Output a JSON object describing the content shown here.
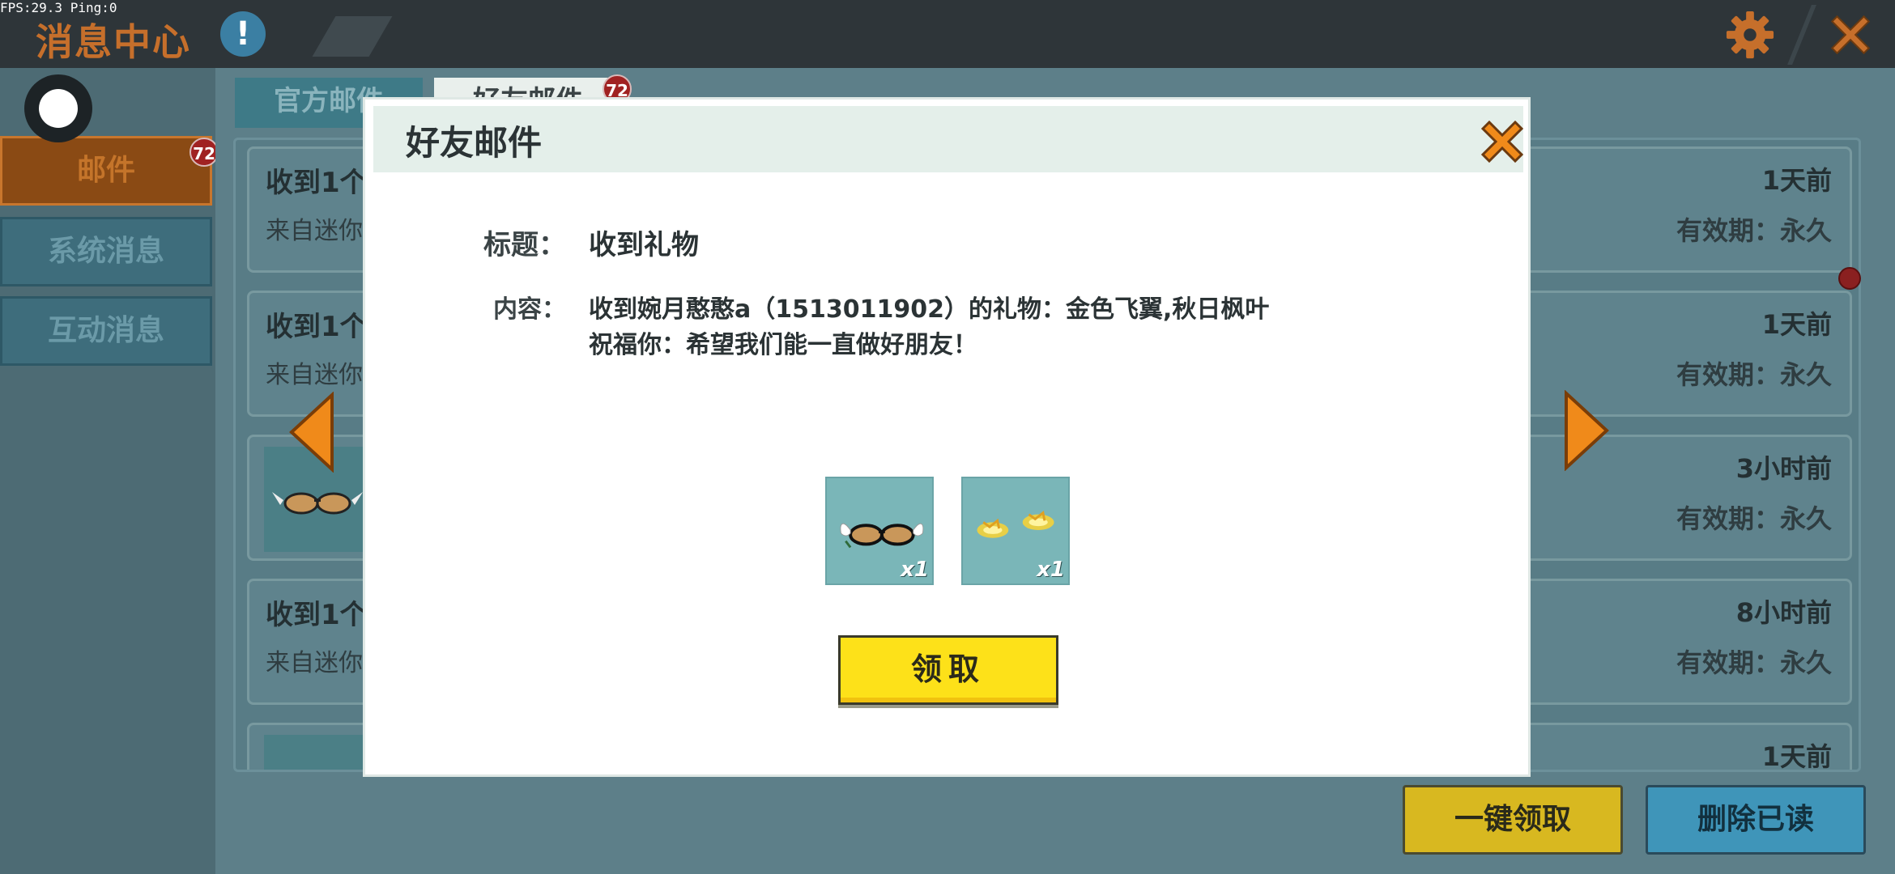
{
  "hud": {
    "fps_text": "FPS:29.3  Ping:0"
  },
  "topbar": {
    "title": "消息中心",
    "info_icon": "!",
    "settings_icon": "gear-icon",
    "close_icon": "close-icon"
  },
  "sidebar": {
    "items": [
      {
        "label": "邮件",
        "badge": "72",
        "active": true
      },
      {
        "label": "系统消息",
        "active": false
      },
      {
        "label": "互动消息",
        "active": false
      }
    ]
  },
  "tabs": [
    {
      "label": "官方邮件",
      "active": false
    },
    {
      "label": "好友邮件",
      "badge": "72",
      "active": true
    }
  ],
  "mail_list": [
    {
      "title": "收到1个",
      "from": "来自迷你",
      "time": "1天前",
      "validity": "有效期：永久"
    },
    {
      "title": "收到1个",
      "from": "来自迷你",
      "time": "1天前",
      "validity": "有效期：永久"
    },
    {
      "title": "",
      "from": "",
      "time": "3小时前",
      "validity": "有效期：永久",
      "thumb": "glasses-icon"
    },
    {
      "title": "收到1个",
      "from": "来自迷你",
      "time": "8小时前",
      "validity": "有效期：永久"
    },
    {
      "title": "",
      "from": "",
      "time": "1天前",
      "validity": ""
    }
  ],
  "actions": {
    "claim_all": "一键领取",
    "delete_read": "删除已读"
  },
  "modal": {
    "title": "好友邮件",
    "subject_label": "标题：",
    "subject_value": "收到礼物",
    "content_label": "内容：",
    "content_line1": "收到婉月憨憨a（1513011902）的礼物：金色飞翼,秋日枫叶",
    "content_line2": "祝福你：希望我们能一直做好朋友！",
    "gifts": [
      {
        "name": "金色飞翼",
        "icon": "winged-glasses-icon",
        "qty": "x1"
      },
      {
        "name": "秋日枫叶",
        "icon": "golden-leaves-icon",
        "qty": "x1"
      }
    ],
    "claim_label": "领取"
  },
  "colors": {
    "accent_orange": "#f08a1a",
    "claim_yellow": "#fde119",
    "panel_teal": "#5d7f89",
    "badge_red": "#a02222"
  }
}
